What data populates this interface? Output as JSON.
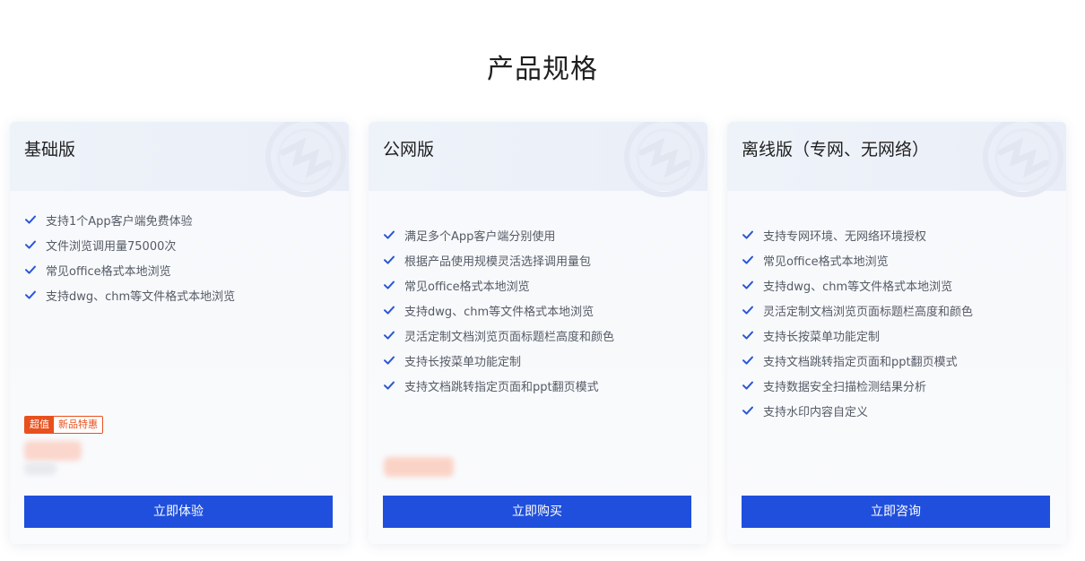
{
  "page": {
    "title": "产品规格"
  },
  "colors": {
    "accent": "#1f4fdc",
    "check": "#2b57d6",
    "promo": "#e8501d"
  },
  "icons": {
    "check": "check-icon"
  },
  "cards": [
    {
      "title": "基础版",
      "features": [
        "支持1个App客户端免费体验",
        "文件浏览调用量75000次",
        "常见office格式本地浏览",
        "支持dwg、chm等文件格式本地浏览"
      ],
      "promo": {
        "tag": "超值",
        "text": "新品特惠"
      },
      "button": "立即体验"
    },
    {
      "title": "公网版",
      "features": [
        "满足多个App客户端分别使用",
        "根据产品使用规模灵活选择调用量包",
        "常见office格式本地浏览",
        "支持dwg、chm等文件格式本地浏览",
        "灵活定制文档浏览页面标题栏高度和颜色",
        "支持长按菜单功能定制",
        "支持文档跳转指定页面和ppt翻页模式"
      ],
      "button": "立即购买"
    },
    {
      "title": "离线版（专网、无网络）",
      "features": [
        "支持专网环境、无网络环境授权",
        "常见office格式本地浏览",
        "支持dwg、chm等文件格式本地浏览",
        "灵活定制文档浏览页面标题栏高度和颜色",
        "支持长按菜单功能定制",
        "支持文档跳转指定页面和ppt翻页模式",
        "支持数据安全扫描检测结果分析",
        "支持水印内容自定义"
      ],
      "button": "立即咨询"
    }
  ]
}
